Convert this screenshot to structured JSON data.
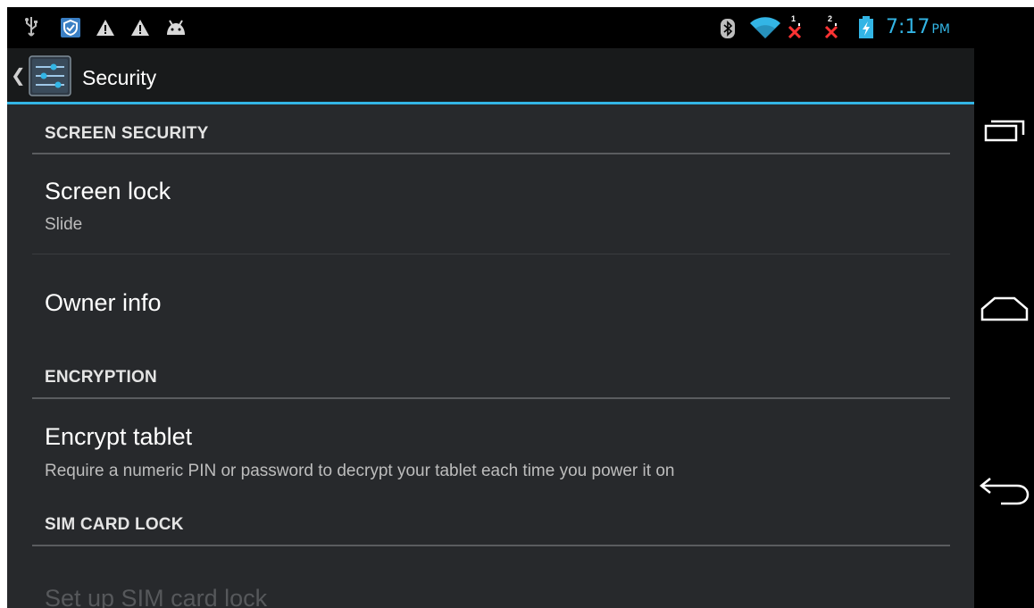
{
  "status_bar": {
    "time": "7:17",
    "ampm": "PM",
    "sim1_label": "1",
    "sim2_label": "2",
    "icons": [
      "usb-icon",
      "shield-app-icon",
      "warning-icon",
      "warning-icon",
      "android-debug-icon",
      "bluetooth-icon",
      "wifi-icon",
      "sim1-no-signal-icon",
      "sim2-no-signal-icon",
      "battery-charging-icon"
    ]
  },
  "action_bar": {
    "title": "Security",
    "icon": "settings-sliders-icon"
  },
  "sections": [
    {
      "header": "SCREEN SECURITY",
      "items": [
        {
          "title": "Screen lock",
          "subtitle": "Slide"
        },
        {
          "title": "Owner info"
        }
      ]
    },
    {
      "header": "ENCRYPTION",
      "items": [
        {
          "title": "Encrypt tablet",
          "subtitle": "Require a numeric PIN or password to decrypt your tablet each time you power it on"
        }
      ]
    },
    {
      "header": "SIM CARD LOCK",
      "items": [
        {
          "title": "Set up SIM card lock",
          "disabled": true
        }
      ]
    }
  ],
  "nav": [
    "recent-apps-icon",
    "home-icon",
    "back-icon"
  ],
  "colors": {
    "accent": "#33b5e5",
    "background": "#27292c",
    "alert": "#ff3333"
  }
}
